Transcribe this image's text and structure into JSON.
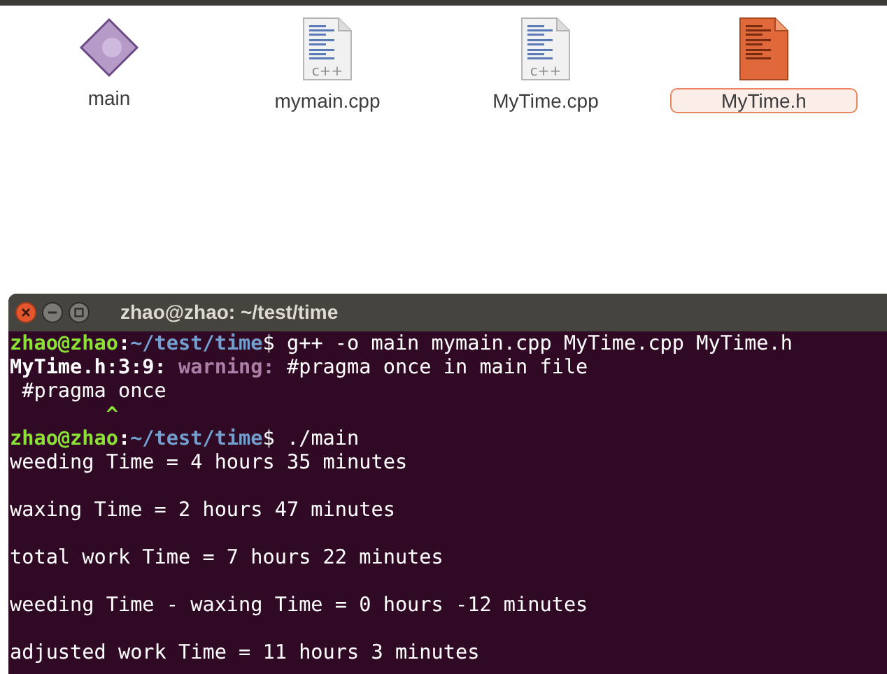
{
  "files": [
    {
      "name": "main",
      "kind": "executable",
      "selected": false
    },
    {
      "name": "mymain.cpp",
      "kind": "source",
      "badge": "c++",
      "selected": false
    },
    {
      "name": "MyTime.cpp",
      "kind": "source",
      "badge": "c++",
      "selected": false
    },
    {
      "name": "MyTime.h",
      "kind": "header",
      "selected": true
    }
  ],
  "terminal": {
    "title": "zhao@zhao: ~/test/time",
    "lines": [
      {
        "kind": "text",
        "segments": [
          {
            "kind": "user",
            "text": "zhao@zhao"
          },
          {
            "kind": "sep",
            "text": ":"
          },
          {
            "kind": "path",
            "text": "~/test/time"
          },
          {
            "kind": "plain",
            "text": "$ g++ -o main mymain.cpp MyTime.cpp MyTime.h"
          }
        ]
      },
      {
        "kind": "text",
        "segments": [
          {
            "kind": "bold",
            "text": "MyTime.h:3:9:"
          },
          {
            "kind": "warning",
            "text": " warning:"
          },
          {
            "kind": "plain",
            "text": " #pragma once in main file"
          }
        ]
      },
      {
        "kind": "text",
        "segments": [
          {
            "kind": "plain",
            "text": " #pragma once"
          }
        ]
      },
      {
        "kind": "text",
        "segments": [
          {
            "kind": "caret",
            "text": "        ^"
          }
        ]
      },
      {
        "kind": "text",
        "segments": [
          {
            "kind": "user",
            "text": "zhao@zhao"
          },
          {
            "kind": "sep",
            "text": ":"
          },
          {
            "kind": "path",
            "text": "~/test/time"
          },
          {
            "kind": "plain",
            "text": "$ ./main"
          }
        ]
      },
      {
        "kind": "text",
        "segments": [
          {
            "kind": "plain",
            "text": "weeding Time = 4 hours 35 minutes"
          }
        ]
      },
      {
        "kind": "blank"
      },
      {
        "kind": "text",
        "segments": [
          {
            "kind": "plain",
            "text": "waxing Time = 2 hours 47 minutes"
          }
        ]
      },
      {
        "kind": "blank"
      },
      {
        "kind": "text",
        "segments": [
          {
            "kind": "plain",
            "text": "total work Time = 7 hours 22 minutes"
          }
        ]
      },
      {
        "kind": "blank"
      },
      {
        "kind": "text",
        "segments": [
          {
            "kind": "plain",
            "text": "weeding Time - waxing Time = 0 hours -12 minutes"
          }
        ]
      },
      {
        "kind": "blank"
      },
      {
        "kind": "text",
        "segments": [
          {
            "kind": "plain",
            "text": "adjusted work Time = 11 hours 3 minutes"
          }
        ]
      }
    ]
  }
}
